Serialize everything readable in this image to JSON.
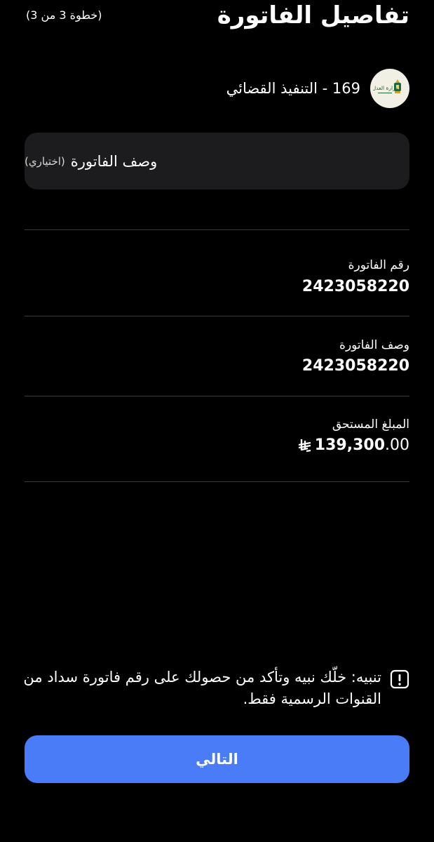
{
  "header": {
    "title": "تفاصيل الفاتورة",
    "step": "(خطوة 3 من 3)"
  },
  "biller": {
    "name": "169 - التنفيذ القضائي",
    "logo_icon": "ministry-of-justice-logo",
    "logo_text": "وزارة العدل"
  },
  "description_field": {
    "label": "وصف الفاتورة",
    "hint": "(اختياري)"
  },
  "details": [
    {
      "label": "رقم الفاتورة",
      "value": "2423058220"
    },
    {
      "label": "وصف الفاتورة",
      "value": "2423058220"
    },
    {
      "label": "المبلغ المستحق",
      "amount_main": "139,300",
      "amount_decimal": ".00",
      "currency_icon": "saudi-riyal-icon"
    }
  ],
  "warning": {
    "icon": "exclamation-icon",
    "text": "تنبيه: خلّك نبيه وتأكد من حصولك على رقم فاتورة سداد من القنوات الرسمية فقط."
  },
  "button": {
    "next_label": "التالي"
  },
  "colors": {
    "background": "#000000",
    "field_background": "#1c1c1e",
    "divider": "#3a3a3c",
    "primary_button": "#4a7cf7",
    "text": "#ffffff"
  }
}
